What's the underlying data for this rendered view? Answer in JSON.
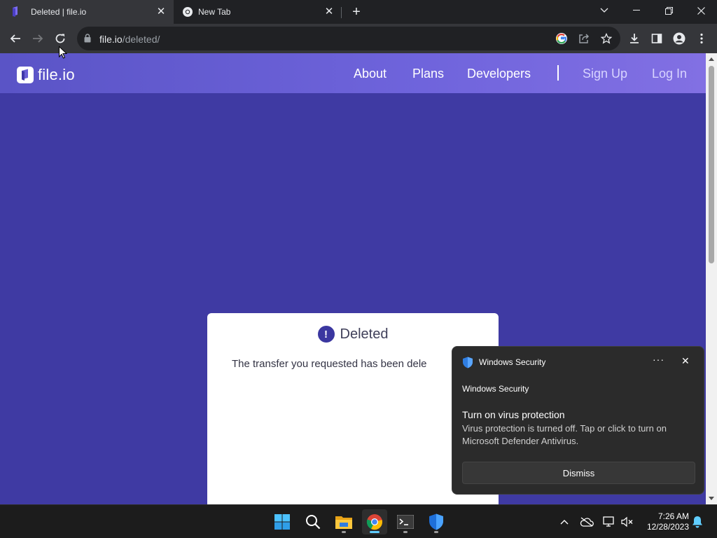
{
  "browser": {
    "tabs": [
      {
        "title": "Deleted | file.io",
        "active": true
      },
      {
        "title": "New Tab",
        "active": false
      }
    ],
    "url": {
      "host": "file.io",
      "path": "/deleted/"
    }
  },
  "page": {
    "logo_text": "file.io",
    "nav": {
      "about": "About",
      "plans": "Plans",
      "developers": "Developers",
      "signup": "Sign Up",
      "login": "Log In"
    },
    "card": {
      "heading": "Deleted",
      "message": "The transfer you requested has been dele"
    },
    "colors": {
      "background": "#3f3aa3",
      "accent": "#3b37a0"
    }
  },
  "toast": {
    "app_name": "Windows Security",
    "sender": "Windows Security",
    "title": "Turn on virus protection",
    "body": "Virus protection is turned off. Tap or click to turn on Microsoft Defender Antivirus.",
    "more": "···",
    "dismiss": "Dismiss"
  },
  "taskbar": {
    "time": "7:26 AM",
    "date": "12/28/2023"
  }
}
